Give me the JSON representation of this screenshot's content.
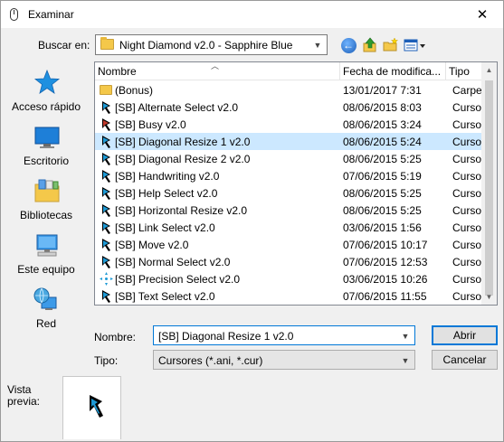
{
  "window": {
    "title": "Examinar",
    "close_label": "✕"
  },
  "lookin": {
    "label": "Buscar en:",
    "value": "Night Diamond v2.0 - Sapphire Blue"
  },
  "toolbar": {
    "back_icon": "back-arrow-icon",
    "up_icon": "up-folder-icon",
    "newfolder_icon": "new-folder-icon",
    "views_icon": "views-menu-icon"
  },
  "places": [
    {
      "label": "Acceso rápido",
      "icon": "star-icon"
    },
    {
      "label": "Escritorio",
      "icon": "desktop-icon"
    },
    {
      "label": "Bibliotecas",
      "icon": "libraries-icon"
    },
    {
      "label": "Este equipo",
      "icon": "computer-icon"
    },
    {
      "label": "Red",
      "icon": "network-icon"
    }
  ],
  "columns": {
    "name": "Nombre",
    "date": "Fecha de modifica...",
    "type": "Tipo"
  },
  "files": [
    {
      "name": "(Bonus)",
      "date": "13/01/2017 7:31",
      "type": "Carpeta",
      "icon": "folder-icon"
    },
    {
      "name": "[SB] Alternate Select v2.0",
      "date": "08/06/2015 8:03",
      "type": "Cursor",
      "icon": "cursor-arrow-icon"
    },
    {
      "name": "[SB] Busy v2.0",
      "date": "08/06/2015 3:24",
      "type": "Cursor",
      "icon": "cursor-busy-icon"
    },
    {
      "name": "[SB] Diagonal Resize 1 v2.0",
      "date": "08/06/2015 5:24",
      "type": "Cursor",
      "icon": "cursor-arrow-icon",
      "selected": true
    },
    {
      "name": "[SB] Diagonal Resize 2 v2.0",
      "date": "08/06/2015 5:25",
      "type": "Cursor",
      "icon": "cursor-arrow-icon"
    },
    {
      "name": "[SB] Handwriting v2.0",
      "date": "07/06/2015 5:19",
      "type": "Cursor",
      "icon": "cursor-arrow-icon"
    },
    {
      "name": "[SB] Help Select v2.0",
      "date": "08/06/2015 5:25",
      "type": "Cursor",
      "icon": "cursor-arrow-icon"
    },
    {
      "name": "[SB] Horizontal Resize v2.0",
      "date": "08/06/2015 5:25",
      "type": "Cursor",
      "icon": "cursor-arrow-icon"
    },
    {
      "name": "[SB] Link Select v2.0",
      "date": "03/06/2015 1:56",
      "type": "Cursor",
      "icon": "cursor-arrow-icon"
    },
    {
      "name": "[SB] Move v2.0",
      "date": "07/06/2015 10:17",
      "type": "Cursor",
      "icon": "cursor-arrow-icon"
    },
    {
      "name": "[SB] Normal Select v2.0",
      "date": "07/06/2015 12:53",
      "type": "Cursor",
      "icon": "cursor-arrow-icon"
    },
    {
      "name": "[SB] Precision Select v2.0",
      "date": "03/06/2015 10:26",
      "type": "Cursor",
      "icon": "crosshair-cursor-icon"
    },
    {
      "name": "[SB] Text Select v2.0",
      "date": "07/06/2015 11:55",
      "type": "Cursor",
      "icon": "cursor-arrow-icon"
    }
  ],
  "filename": {
    "label": "Nombre:",
    "value": "[SB] Diagonal Resize 1 v2.0"
  },
  "filetype": {
    "label": "Tipo:",
    "value": "Cursores (*.ani, *.cur)"
  },
  "buttons": {
    "open": "Abrir",
    "cancel": "Cancelar"
  },
  "preview": {
    "label": "Vista previa:"
  },
  "colors": {
    "accent": "#0078d7",
    "selection": "#cce8ff",
    "cursor_blue": "#1e9ad6"
  }
}
